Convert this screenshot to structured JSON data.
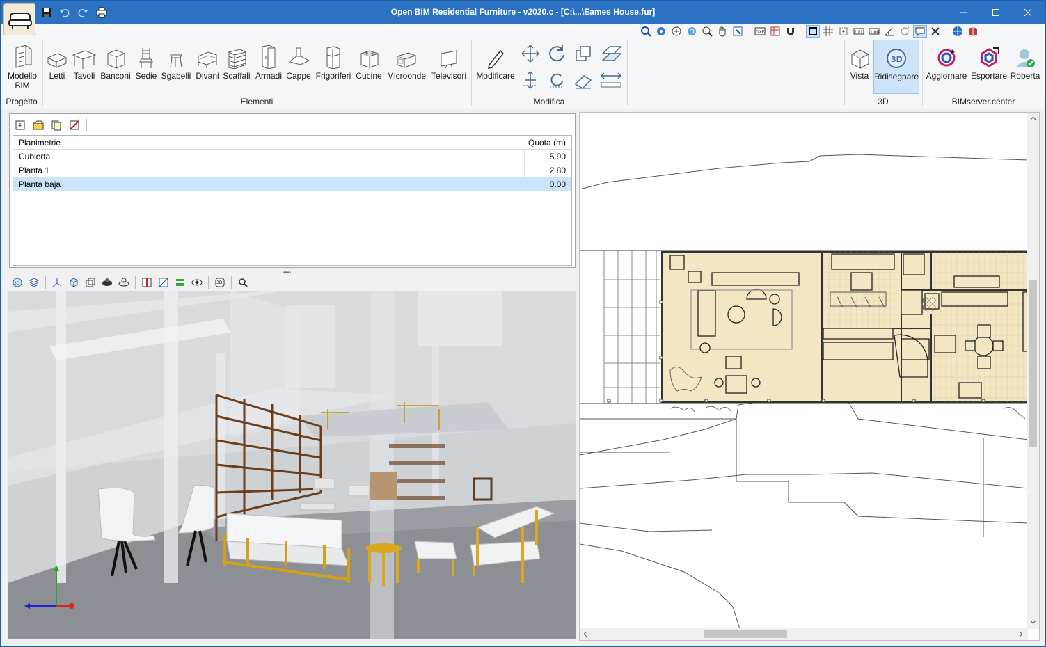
{
  "window": {
    "title": "Open BIM Residential Furniture - v2020.c - [C:\\...\\Eames House.fur]"
  },
  "ribbon": {
    "groups": {
      "progetto": "Progetto",
      "elementi": "Elementi",
      "modifica": "Modifica",
      "view3d": "3D",
      "bimserver": "BIMserver.center"
    },
    "buttons": {
      "modello_bim": "Modello BIM",
      "letti": "Letti",
      "tavoli": "Tavoli",
      "banconi": "Banconi",
      "sedie": "Sedie",
      "sgabelli": "Sgabelli",
      "divani": "Divani",
      "scaffali": "Scaffali",
      "armadi": "Armadi",
      "cappe": "Cappe",
      "frigoriferi": "Frigoriferi",
      "cucine": "Cucine",
      "microonde": "Microonde",
      "televisori": "Televisori",
      "modificare": "Modificare",
      "vista": "Vista",
      "ridisegnare": "Ridisegnare",
      "aggiornare": "Aggiornare",
      "esportare": "Esportare",
      "roberta": "Roberta"
    }
  },
  "floors": {
    "headers": {
      "name": "Planimetrie",
      "level": "Quota (m)"
    },
    "rows": [
      {
        "name": "Cubierta",
        "level": "5.90"
      },
      {
        "name": "Planta 1",
        "level": "2.80"
      },
      {
        "name": "Planta baja",
        "level": "0.00"
      }
    ],
    "selected_index": 2
  },
  "colors": {
    "titlebar": "#2b73c2",
    "selection": "#cce4f7",
    "plan_fill": "#f3e6c2"
  }
}
